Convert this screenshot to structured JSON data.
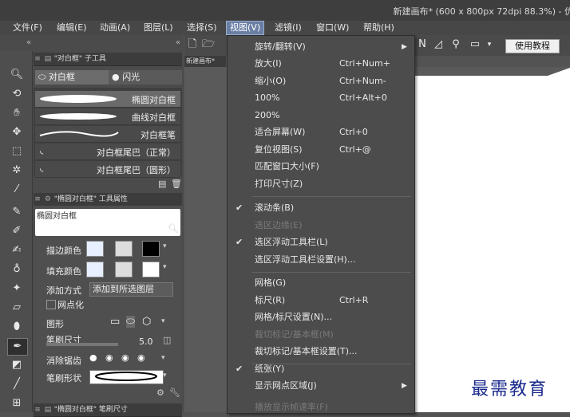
{
  "window": {
    "title": "新建画布* (600 x 800px 72dpi 88.3%) - 优"
  },
  "menubar": [
    {
      "label": "文件(F)"
    },
    {
      "label": "编辑(E)"
    },
    {
      "label": "动画(A)"
    },
    {
      "label": "图层(L)"
    },
    {
      "label": "选择(S)"
    },
    {
      "label": "视图(V)"
    },
    {
      "label": "滤镜(I)"
    },
    {
      "label": "窗口(W)"
    },
    {
      "label": "帮助(H)"
    }
  ],
  "subtool_panel": {
    "header": "\"对白框\" 子工具",
    "tabs": [
      "对白框",
      "闪光"
    ],
    "items": [
      "椭圆对白框",
      "曲线对白框",
      "对白框笔",
      "对白框尾巴（正常）",
      "对白框尾巴（圆形）"
    ]
  },
  "properties_panel": {
    "header": "\"椭圆对白框\" 工具属性",
    "preview_label": "椭圆对白框",
    "stroke_color_label": "描边颜色",
    "fill_color_label": "填充颜色",
    "add_mode_label": "添加方式",
    "add_mode_value": "添加到所选图层",
    "rasterize_label": "网点化",
    "shape_label": "图形",
    "brush_size_label": "笔刷尺寸",
    "brush_size_value": "5.0",
    "antialias_label": "消除锯齿",
    "brush_shape_label": "笔刷形状"
  },
  "bottom_panel": {
    "header": "\"椭圆对白框\" 笔刷尺寸"
  },
  "canvas": {
    "tab_label": "新建画布*"
  },
  "toolbar": {
    "tutorial_button": "使用教程"
  },
  "view_menu": {
    "items": [
      {
        "label": "旋转/翻转(V)",
        "shortcut": "",
        "checked": false,
        "disabled": false,
        "submenu": true
      },
      {
        "label": "放大(I)",
        "shortcut": "Ctrl+Num+",
        "checked": false,
        "disabled": false,
        "submenu": false
      },
      {
        "label": "缩小(O)",
        "shortcut": "Ctrl+Num-",
        "checked": false,
        "disabled": false,
        "submenu": false
      },
      {
        "label": "100%",
        "shortcut": "Ctrl+Alt+0",
        "checked": false,
        "disabled": false,
        "submenu": false
      },
      {
        "label": "200%",
        "shortcut": "",
        "checked": false,
        "disabled": false,
        "submenu": false
      },
      {
        "label": "适合屏幕(W)",
        "shortcut": "Ctrl+0",
        "checked": false,
        "disabled": false,
        "submenu": false
      },
      {
        "label": "复位视图(S)",
        "shortcut": "Ctrl+@",
        "checked": false,
        "disabled": false,
        "submenu": false
      },
      {
        "label": "匹配窗口大小(F)",
        "shortcut": "",
        "checked": false,
        "disabled": false,
        "submenu": false
      },
      {
        "label": "打印尺寸(Z)",
        "shortcut": "",
        "checked": false,
        "disabled": false,
        "submenu": false
      },
      {
        "label": "滚动条(B)",
        "shortcut": "",
        "checked": true,
        "disabled": false,
        "submenu": false
      },
      {
        "label": "选区边缘(E)",
        "shortcut": "",
        "checked": false,
        "disabled": true,
        "submenu": false
      },
      {
        "label": "选区浮动工具栏(L)",
        "shortcut": "",
        "checked": true,
        "disabled": false,
        "submenu": false
      },
      {
        "label": "选区浮动工具栏设置(H)...",
        "shortcut": "",
        "checked": false,
        "disabled": false,
        "submenu": false
      },
      {
        "label": "网格(G)",
        "shortcut": "",
        "checked": false,
        "disabled": false,
        "submenu": false
      },
      {
        "label": "标尺(R)",
        "shortcut": "Ctrl+R",
        "checked": false,
        "disabled": false,
        "submenu": false
      },
      {
        "label": "网格/标尺设置(N)...",
        "shortcut": "",
        "checked": false,
        "disabled": false,
        "submenu": false
      },
      {
        "label": "裁切标记/基本框(M)",
        "shortcut": "",
        "checked": false,
        "disabled": true,
        "submenu": false
      },
      {
        "label": "裁切标记/基本框设置(T)...",
        "shortcut": "",
        "checked": false,
        "disabled": false,
        "submenu": false
      },
      {
        "label": "纸张(Y)",
        "shortcut": "",
        "checked": true,
        "disabled": false,
        "submenu": false
      },
      {
        "label": "显示网点区域(J)",
        "shortcut": "",
        "checked": false,
        "disabled": false,
        "submenu": true
      },
      {
        "label": "播放显示帧速率(F)",
        "shortcut": "",
        "checked": false,
        "disabled": true,
        "submenu": false
      }
    ]
  },
  "watermark": "最需教育",
  "colors": {
    "menu_highlight": "#6b7fa5",
    "paper": "#ffffff",
    "watermark": "#1a2a8c"
  }
}
